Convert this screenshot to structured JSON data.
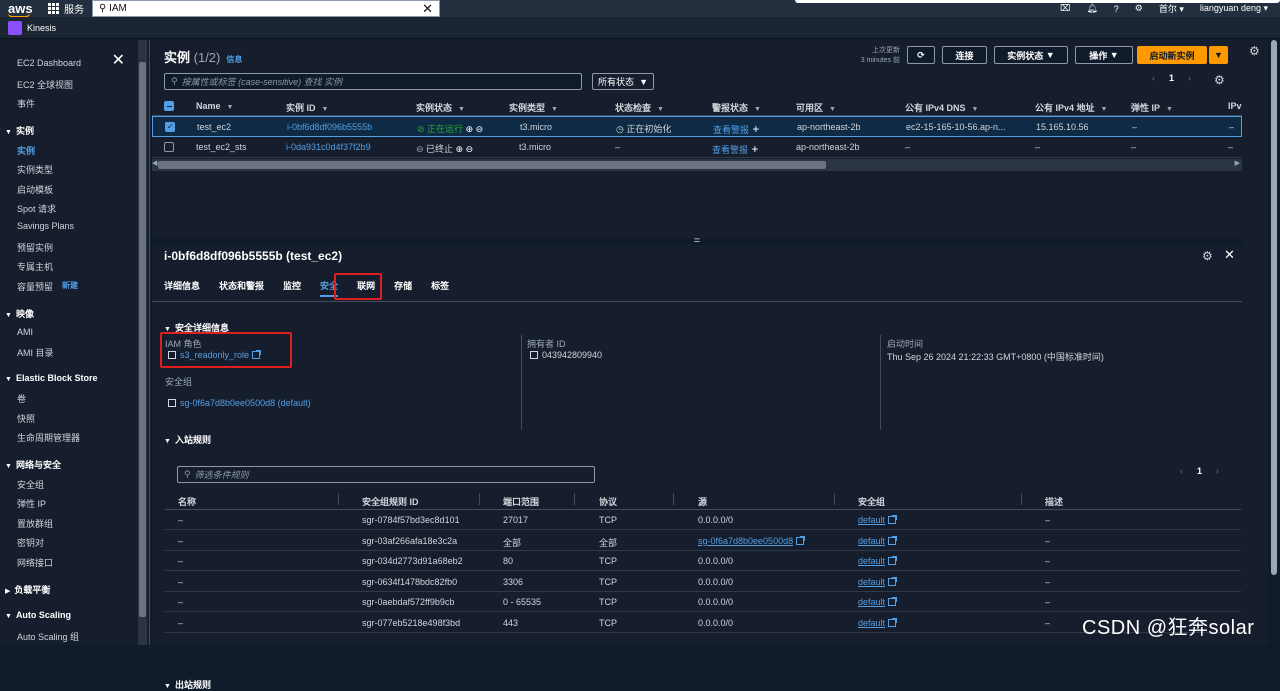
{
  "topbar": {
    "logo": "aws",
    "services_label": "服务",
    "search_value": "IAM",
    "region": "首尔",
    "user": "liangyuan deng"
  },
  "favorite": {
    "label": "Kinesis"
  },
  "sidebar": {
    "items": [
      {
        "label": "EC2 Dashboard",
        "type": "item"
      },
      {
        "label": "EC2 全球视图",
        "type": "item"
      },
      {
        "label": "事件",
        "type": "item"
      },
      {
        "label": "实例",
        "type": "head"
      },
      {
        "label": "实例",
        "type": "active"
      },
      {
        "label": "实例类型",
        "type": "item"
      },
      {
        "label": "启动模板",
        "type": "item"
      },
      {
        "label": "Spot 请求",
        "type": "item"
      },
      {
        "label": "Savings Plans",
        "type": "item"
      },
      {
        "label": "预留实例",
        "type": "item"
      },
      {
        "label": "专属主机",
        "type": "item"
      },
      {
        "label": "容量预留",
        "type": "item",
        "badge": "新建"
      },
      {
        "label": "映像",
        "type": "head"
      },
      {
        "label": "AMI",
        "type": "item"
      },
      {
        "label": "AMI 目录",
        "type": "item"
      },
      {
        "label": "Elastic Block Store",
        "type": "head"
      },
      {
        "label": "卷",
        "type": "item"
      },
      {
        "label": "快照",
        "type": "item"
      },
      {
        "label": "生命周期管理器",
        "type": "item"
      },
      {
        "label": "网络与安全",
        "type": "head"
      },
      {
        "label": "安全组",
        "type": "item"
      },
      {
        "label": "弹性 IP",
        "type": "item"
      },
      {
        "label": "置放群组",
        "type": "item"
      },
      {
        "label": "密钥对",
        "type": "item"
      },
      {
        "label": "网络接口",
        "type": "item"
      },
      {
        "label": "负载平衡",
        "type": "headc"
      },
      {
        "label": "Auto Scaling",
        "type": "head"
      },
      {
        "label": "Auto Scaling 组",
        "type": "item"
      }
    ]
  },
  "instances": {
    "title": "实例",
    "count": "(1/2)",
    "info": "信息",
    "last_updated_1": "上次更新",
    "last_updated_2": "3 minutes 前",
    "connect": "连接",
    "state": "实例状态",
    "actions": "操作",
    "launch": "启动新实例",
    "filter_placeholder": "按属性或标签 (case-sensitive) 查找 实例",
    "status_select": "所有状态",
    "page": "1",
    "columns": [
      "Name",
      "实例 ID",
      "实例状态",
      "实例类型",
      "状态检查",
      "警报状态",
      "可用区",
      "公有 IPv4 DNS",
      "公有 IPv4 地址",
      "弹性 IP",
      "IPv"
    ],
    "rows": [
      {
        "name": "test_ec2",
        "id": "i-0bf6d8df096b5555b",
        "state": "正在运行",
        "type": "t3.micro",
        "check": "正在初始化",
        "alarm": "查看警报",
        "az": "ap-northeast-2b",
        "dns": "ec2-15-165-10-56.ap-n...",
        "ip": "15.165.10.56",
        "eip": "–",
        "ipv6": "–"
      },
      {
        "name": "test_ec2_sts",
        "id": "i-0da931c0d4f37f2b9",
        "state": "已终止",
        "type": "t3.micro",
        "check": "–",
        "alarm": "查看警报",
        "az": "ap-northeast-2b",
        "dns": "–",
        "ip": "–",
        "eip": "–",
        "ipv6": "–"
      }
    ]
  },
  "detail": {
    "title": "i-0bf6d8df096b5555b (test_ec2)",
    "tabs": [
      "详细信息",
      "状态和警报",
      "监控",
      "安全",
      "联网",
      "存储",
      "标签"
    ],
    "security_details": "安全详细信息",
    "iam_role_label": "IAM 角色",
    "iam_role": "s3_readonly_role",
    "owner_label": "拥有者 ID",
    "owner": "043942809940",
    "launch_label": "启动时间",
    "launch": "Thu Sep 26 2024 21:22:33 GMT+0800 (中国标准时间)",
    "sg_label": "安全组",
    "sg": "sg-0f6a7d8b0ee0500d8 (default)",
    "inbound": "入站规则",
    "rules_placeholder": "筛选条件规则",
    "rules_page": "1",
    "rule_columns": [
      "名称",
      "安全组规则 ID",
      "端口范围",
      "协议",
      "源",
      "安全组",
      "描述"
    ],
    "rules": [
      {
        "name": "–",
        "id": "sgr-0784f57bd3ec8d101",
        "port": "27017",
        "proto": "TCP",
        "src": "0.0.0.0/0",
        "src_link": false,
        "sg": "default",
        "desc": "–"
      },
      {
        "name": "–",
        "id": "sgr-03af266afa18e3c2a",
        "port": "全部",
        "proto": "全部",
        "src": "sg-0f6a7d8b0ee0500d8",
        "src_link": true,
        "sg": "default",
        "desc": "–"
      },
      {
        "name": "–",
        "id": "sgr-034d2773d91a68eb2",
        "port": "80",
        "proto": "TCP",
        "src": "0.0.0.0/0",
        "src_link": false,
        "sg": "default",
        "desc": "–"
      },
      {
        "name": "–",
        "id": "sgr-0634f1478bdc82fb0",
        "port": "3306",
        "proto": "TCP",
        "src": "0.0.0.0/0",
        "src_link": false,
        "sg": "default",
        "desc": "–"
      },
      {
        "name": "–",
        "id": "sgr-0aebdaf572ff9b9cb",
        "port": "0 - 65535",
        "proto": "TCP",
        "src": "0.0.0.0/0",
        "src_link": false,
        "sg": "default",
        "desc": "–"
      },
      {
        "name": "–",
        "id": "sgr-077eb5218e498f3bd",
        "port": "443",
        "proto": "TCP",
        "src": "0.0.0.0/0",
        "src_link": false,
        "sg": "default",
        "desc": "–"
      }
    ],
    "outbound": "出站规则"
  },
  "watermark": "CSDN @狂奔solar"
}
